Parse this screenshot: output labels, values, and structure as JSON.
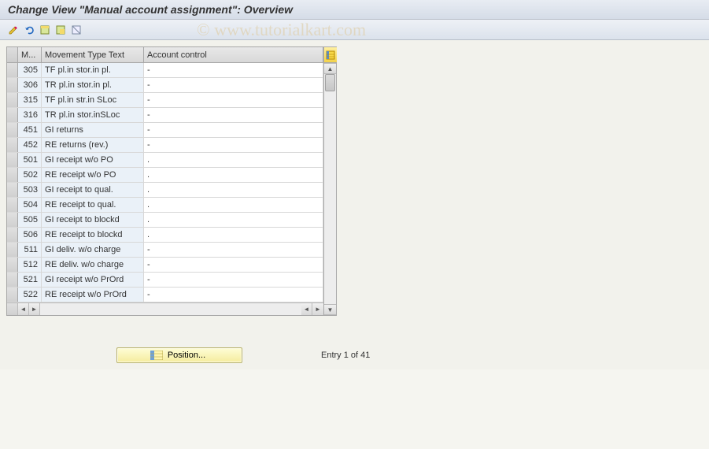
{
  "header": {
    "title": "Change View \"Manual account assignment\": Overview"
  },
  "watermark": "© www.tutorialkart.com",
  "columns": {
    "selector": "",
    "movement_code": "M...",
    "movement_text": "Movement Type Text",
    "account_control": "Account control"
  },
  "rows": [
    {
      "m": "305",
      "text": "TF pl.in stor.in pl.",
      "acc": "-"
    },
    {
      "m": "306",
      "text": "TR pl.in stor.in pl.",
      "acc": "-"
    },
    {
      "m": "315",
      "text": "TF pl.in str.in SLoc",
      "acc": "-"
    },
    {
      "m": "316",
      "text": "TR pl.in stor.inSLoc",
      "acc": "-"
    },
    {
      "m": "451",
      "text": "GI returns",
      "acc": "-"
    },
    {
      "m": "452",
      "text": "RE returns (rev.)",
      "acc": "-"
    },
    {
      "m": "501",
      "text": "GI receipt w/o PO",
      "acc": "."
    },
    {
      "m": "502",
      "text": "RE receipt w/o PO",
      "acc": "."
    },
    {
      "m": "503",
      "text": "GI receipt to qual.",
      "acc": "."
    },
    {
      "m": "504",
      "text": "RE receipt to qual.",
      "acc": "."
    },
    {
      "m": "505",
      "text": "GI receipt to blockd",
      "acc": "."
    },
    {
      "m": "506",
      "text": "RE receipt to blockd",
      "acc": "."
    },
    {
      "m": "511",
      "text": "GI deliv. w/o charge",
      "acc": "-"
    },
    {
      "m": "512",
      "text": "RE deliv. w/o charge",
      "acc": "-"
    },
    {
      "m": "521",
      "text": "GI receipt w/o PrOrd",
      "acc": "-"
    },
    {
      "m": "522",
      "text": "RE receipt w/o PrOrd",
      "acc": "-"
    }
  ],
  "footer": {
    "position_label": "Position...",
    "entry_text": "Entry 1 of 41"
  }
}
